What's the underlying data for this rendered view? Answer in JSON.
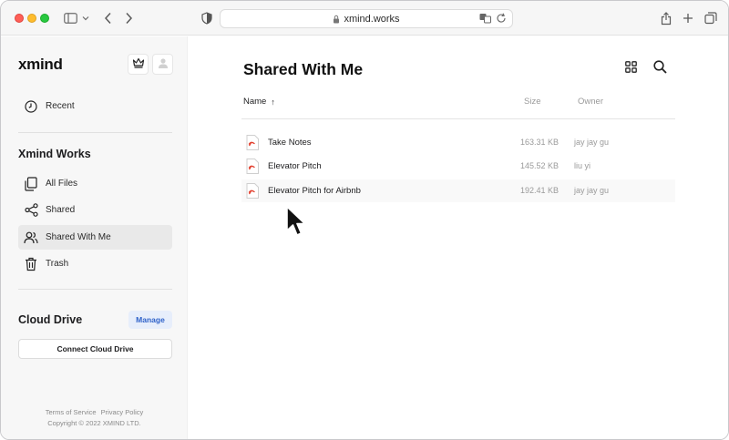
{
  "browser": {
    "url": "xmind.works"
  },
  "sidebar": {
    "logo": "xmind",
    "recent_label": "Recent",
    "section_title": "Xmind Works",
    "items": [
      {
        "label": "All Files",
        "icon": "files-icon"
      },
      {
        "label": "Shared",
        "icon": "share-icon"
      },
      {
        "label": "Shared With Me",
        "icon": "people-icon",
        "active": true
      },
      {
        "label": "Trash",
        "icon": "trash-icon"
      }
    ],
    "cloud_title": "Cloud Drive",
    "manage_label": "Manage",
    "connect_label": "Connect Cloud Drive",
    "footer": {
      "terms": "Terms of Service",
      "privacy": "Privacy Policy",
      "copyright": "Copyright © 2022 XMIND LTD."
    }
  },
  "main": {
    "title": "Shared With Me",
    "columns": {
      "name": "Name",
      "sort_arrow": "↑",
      "size": "Size",
      "owner": "Owner"
    },
    "files": [
      {
        "name": "Take Notes",
        "size": "163.31 KB",
        "owner": "jay jay gu"
      },
      {
        "name": "Elevator Pitch",
        "size": "145.52 KB",
        "owner": "liu yi"
      },
      {
        "name": "Elevator Pitch for Airbnb",
        "size": "192.41 KB",
        "owner": "jay jay gu"
      }
    ]
  },
  "colors": {
    "accent": "#2f62c9",
    "file_icon_red": "#e2402f",
    "sidebar_bg": "#f7f7f7"
  }
}
